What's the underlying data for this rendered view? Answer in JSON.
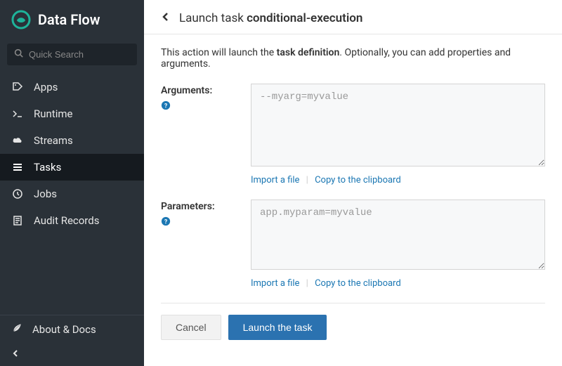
{
  "brand": {
    "title": "Data Flow"
  },
  "search": {
    "placeholder": "Quick Search"
  },
  "sidebar": {
    "items": [
      {
        "label": "Apps"
      },
      {
        "label": "Runtime"
      },
      {
        "label": "Streams"
      },
      {
        "label": "Tasks"
      },
      {
        "label": "Jobs"
      },
      {
        "label": "Audit Records"
      }
    ],
    "footer": {
      "label": "About & Docs"
    }
  },
  "header": {
    "prefix": "Launch task ",
    "task_name": "conditional-execution"
  },
  "intro": {
    "pre": "This action will launch the ",
    "bold": "task definition",
    "post": ". Optionally, you can add properties and arguments."
  },
  "arguments": {
    "label": "Arguments:",
    "placeholder": "--myarg=myvalue",
    "import_label": "Import a file",
    "copy_label": "Copy to the clipboard"
  },
  "parameters": {
    "label": "Parameters:",
    "placeholder": "app.myparam=myvalue",
    "import_label": "Import a file",
    "copy_label": "Copy to the clipboard"
  },
  "actions": {
    "cancel": "Cancel",
    "launch": "Launch the task"
  }
}
